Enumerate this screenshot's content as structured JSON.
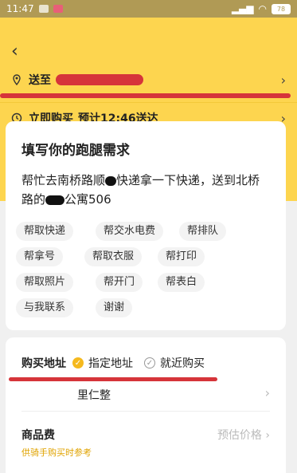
{
  "status_bar": {
    "time": "11:47",
    "battery": "78"
  },
  "header": {
    "back_icon": "back-arrow-icon",
    "deliver_label": "送至",
    "deliver_address_redacted": "",
    "time_option": "立即购买",
    "time_estimate": "预计12:46送达"
  },
  "need_card": {
    "title": "填写你的跑腿需求",
    "message_part1": "帮忙去南桥路顺",
    "message_part2": "快递拿一下快递，送到北桥路的",
    "message_part3": "公寓506",
    "tags": [
      "帮取快递",
      "帮交水电费",
      "帮排队",
      "帮拿号",
      "帮取衣服",
      "帮打印",
      "帮取照片",
      "帮开门",
      "帮表白",
      "与我联系",
      "谢谢"
    ]
  },
  "address_card": {
    "label": "购买地址",
    "option_selected": "指定地址",
    "option_other": "就近购买",
    "address_value": "里仁整",
    "fee_title": "商品费",
    "fee_note": "供骑手购买时参考",
    "fee_placeholder": "预估价格"
  },
  "colors": {
    "primary_yellow": "#fdd54f",
    "accent_orange": "#f5b91e",
    "redline": "#d6343a"
  }
}
